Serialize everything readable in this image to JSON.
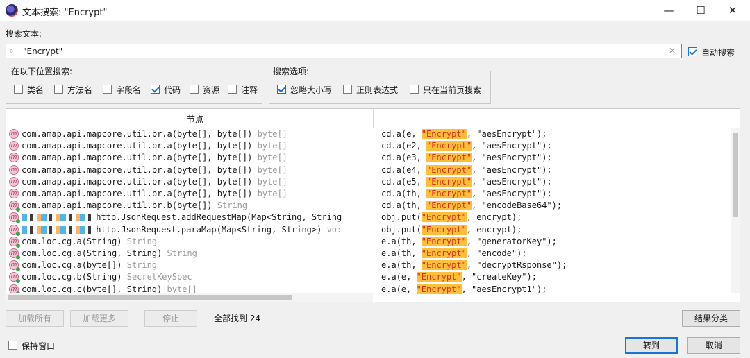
{
  "window": {
    "title": "文本搜索: \"Encrypt\"",
    "minimize": "—",
    "maximize": "☐",
    "close": "✕"
  },
  "search": {
    "label": "搜索文本:",
    "value": "\"Encrypt\"",
    "auto_search_label": "自动搜索",
    "auto_search_checked": true
  },
  "location_group": {
    "title": "在以下位置搜索:",
    "options": [
      {
        "label": "类名",
        "checked": false
      },
      {
        "label": "方法名",
        "checked": false
      },
      {
        "label": "字段名",
        "checked": false
      },
      {
        "label": "代码",
        "checked": true
      },
      {
        "label": "资源",
        "checked": false
      },
      {
        "label": "注释",
        "checked": false
      }
    ]
  },
  "options_group": {
    "title": "搜索选项:",
    "options": [
      {
        "label": "忽略大小写",
        "checked": true
      },
      {
        "label": "正则表达式",
        "checked": false
      },
      {
        "label": "只在当前页搜索",
        "checked": false
      }
    ]
  },
  "table": {
    "column_node": "节点",
    "rows": [
      {
        "icon": "m",
        "static": false,
        "sig": "com.amap.api.mapcore.util.br.a(byte[], byte[]) ",
        "ret": "byte[]",
        "pre": "cd.a(e, ",
        "match": "\"Encrypt\"",
        "post": ", \"aesEncrypt\");"
      },
      {
        "icon": "m",
        "static": false,
        "sig": "com.amap.api.mapcore.util.br.a(byte[], byte[]) ",
        "ret": "byte[]",
        "pre": "cd.a(e2, ",
        "match": "\"Encrypt\"",
        "post": ", \"aesEncrypt\");"
      },
      {
        "icon": "m",
        "static": false,
        "sig": "com.amap.api.mapcore.util.br.a(byte[], byte[]) ",
        "ret": "byte[]",
        "pre": "cd.a(e3, ",
        "match": "\"Encrypt\"",
        "post": ", \"aesEncrypt\");"
      },
      {
        "icon": "m",
        "static": false,
        "sig": "com.amap.api.mapcore.util.br.a(byte[], byte[]) ",
        "ret": "byte[]",
        "pre": "cd.a(e4, ",
        "match": "\"Encrypt\"",
        "post": ", \"aesEncrypt\");"
      },
      {
        "icon": "m",
        "static": false,
        "sig": "com.amap.api.mapcore.util.br.a(byte[], byte[]) ",
        "ret": "byte[]",
        "pre": "cd.a(e5, ",
        "match": "\"Encrypt\"",
        "post": ", \"aesEncrypt\");"
      },
      {
        "icon": "m",
        "static": false,
        "sig": "com.amap.api.mapcore.util.br.a(byte[], byte[]) ",
        "ret": "byte[]",
        "pre": "cd.a(th, ",
        "match": "\"Encrypt\"",
        "post": ", \"aesEncrypt\");"
      },
      {
        "icon": "m",
        "static": true,
        "sig": "com.amap.api.mapcore.util.br.b(byte[]) ",
        "ret": "String",
        "pre": "cd.a(th, ",
        "match": "\"Encrypt\"",
        "post": ", \"encodeBase64\");"
      },
      {
        "icon": "m",
        "static": true,
        "blur": true,
        "sig": "http.JsonRequest.addRequestMap(Map<String, String",
        "ret": "",
        "pre": "obj.put(",
        "match": "\"Encrypt\"",
        "post": ", encrypt);"
      },
      {
        "icon": "m",
        "static": true,
        "blur": true,
        "sig": "http.JsonRequest.paraMap(Map<String, String>) ",
        "ret": "vo:",
        "pre": "obj.put(",
        "match": "\"Encrypt\"",
        "post": ", encrypt);"
      },
      {
        "icon": "m",
        "static": true,
        "sig": "com.loc.cg.a(String) ",
        "ret": "String",
        "pre": "e.a(th, ",
        "match": "\"Encrypt\"",
        "post": ", \"generatorKey\");"
      },
      {
        "icon": "m",
        "static": true,
        "sig": "com.loc.cg.a(String, String) ",
        "ret": "String",
        "pre": "e.a(th, ",
        "match": "\"Encrypt\"",
        "post": ", \"encode\");"
      },
      {
        "icon": "m",
        "static": true,
        "sig": "com.loc.cg.a(byte[]) ",
        "ret": "String",
        "pre": "e.a(th, ",
        "match": "\"Encrypt\"",
        "post": ", \"decryptRsponse\");"
      },
      {
        "icon": "m",
        "static": true,
        "sig": "com.loc.cg.b(String) ",
        "ret": "SecretKeySpec",
        "pre": "e.a(e, ",
        "match": "\"Encrypt\"",
        "post": ", \"createKey\");"
      },
      {
        "icon": "m",
        "static": true,
        "sig": "com.loc.cg.c(byte[], String) ",
        "ret": "byte[]",
        "pre": "e.a(e, ",
        "match": "\"Encrypt\"",
        "post": ", \"aesEncrypt1\");"
      }
    ]
  },
  "footer": {
    "load_all": "加载所有",
    "load_more": "加载更多",
    "stop": "停止",
    "found_text": "全部找到 24",
    "classify": "结果分类",
    "keep_window": "保持窗口",
    "keep_window_checked": false,
    "goto": "转到",
    "cancel": "取消"
  }
}
